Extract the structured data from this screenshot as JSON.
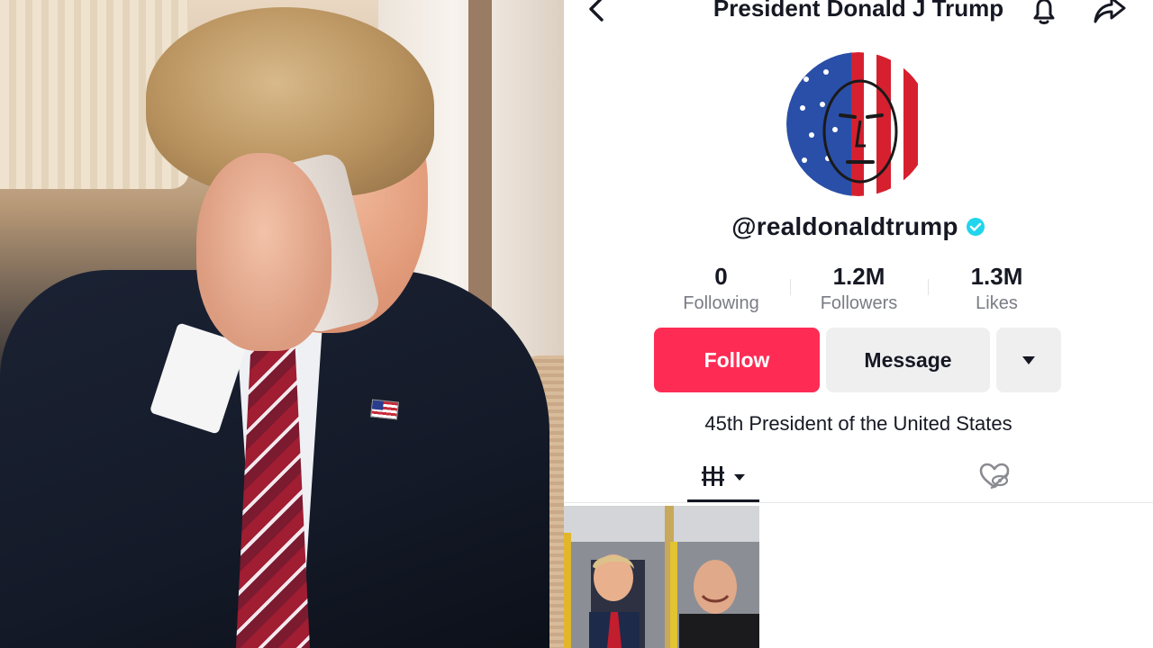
{
  "photo": {
    "subject": "man-on-phone-photo"
  },
  "profile": {
    "title": "President Donald J Trump",
    "handle": "@realdonaldtrump",
    "verified": true,
    "stats": [
      {
        "value": "0",
        "label": "Following"
      },
      {
        "value": "1.2M",
        "label": "Followers"
      },
      {
        "value": "1.3M",
        "label": "Likes"
      }
    ],
    "buttons": {
      "follow_label": "Follow",
      "message_label": "Message"
    },
    "bio": "45th President of the United States",
    "icons": {
      "back": "chevron-left-icon",
      "bell": "bell-icon",
      "share": "share-arrow-icon",
      "more": "caret-down-icon",
      "videos_tab": "grid-icon",
      "liked_tab": "hidden-heart-icon"
    }
  },
  "colors": {
    "accent": "#fe2c55",
    "text": "#161823",
    "muted": "#7a7c85",
    "verified": "#20d5ec",
    "button_gray": "#efeff0"
  }
}
